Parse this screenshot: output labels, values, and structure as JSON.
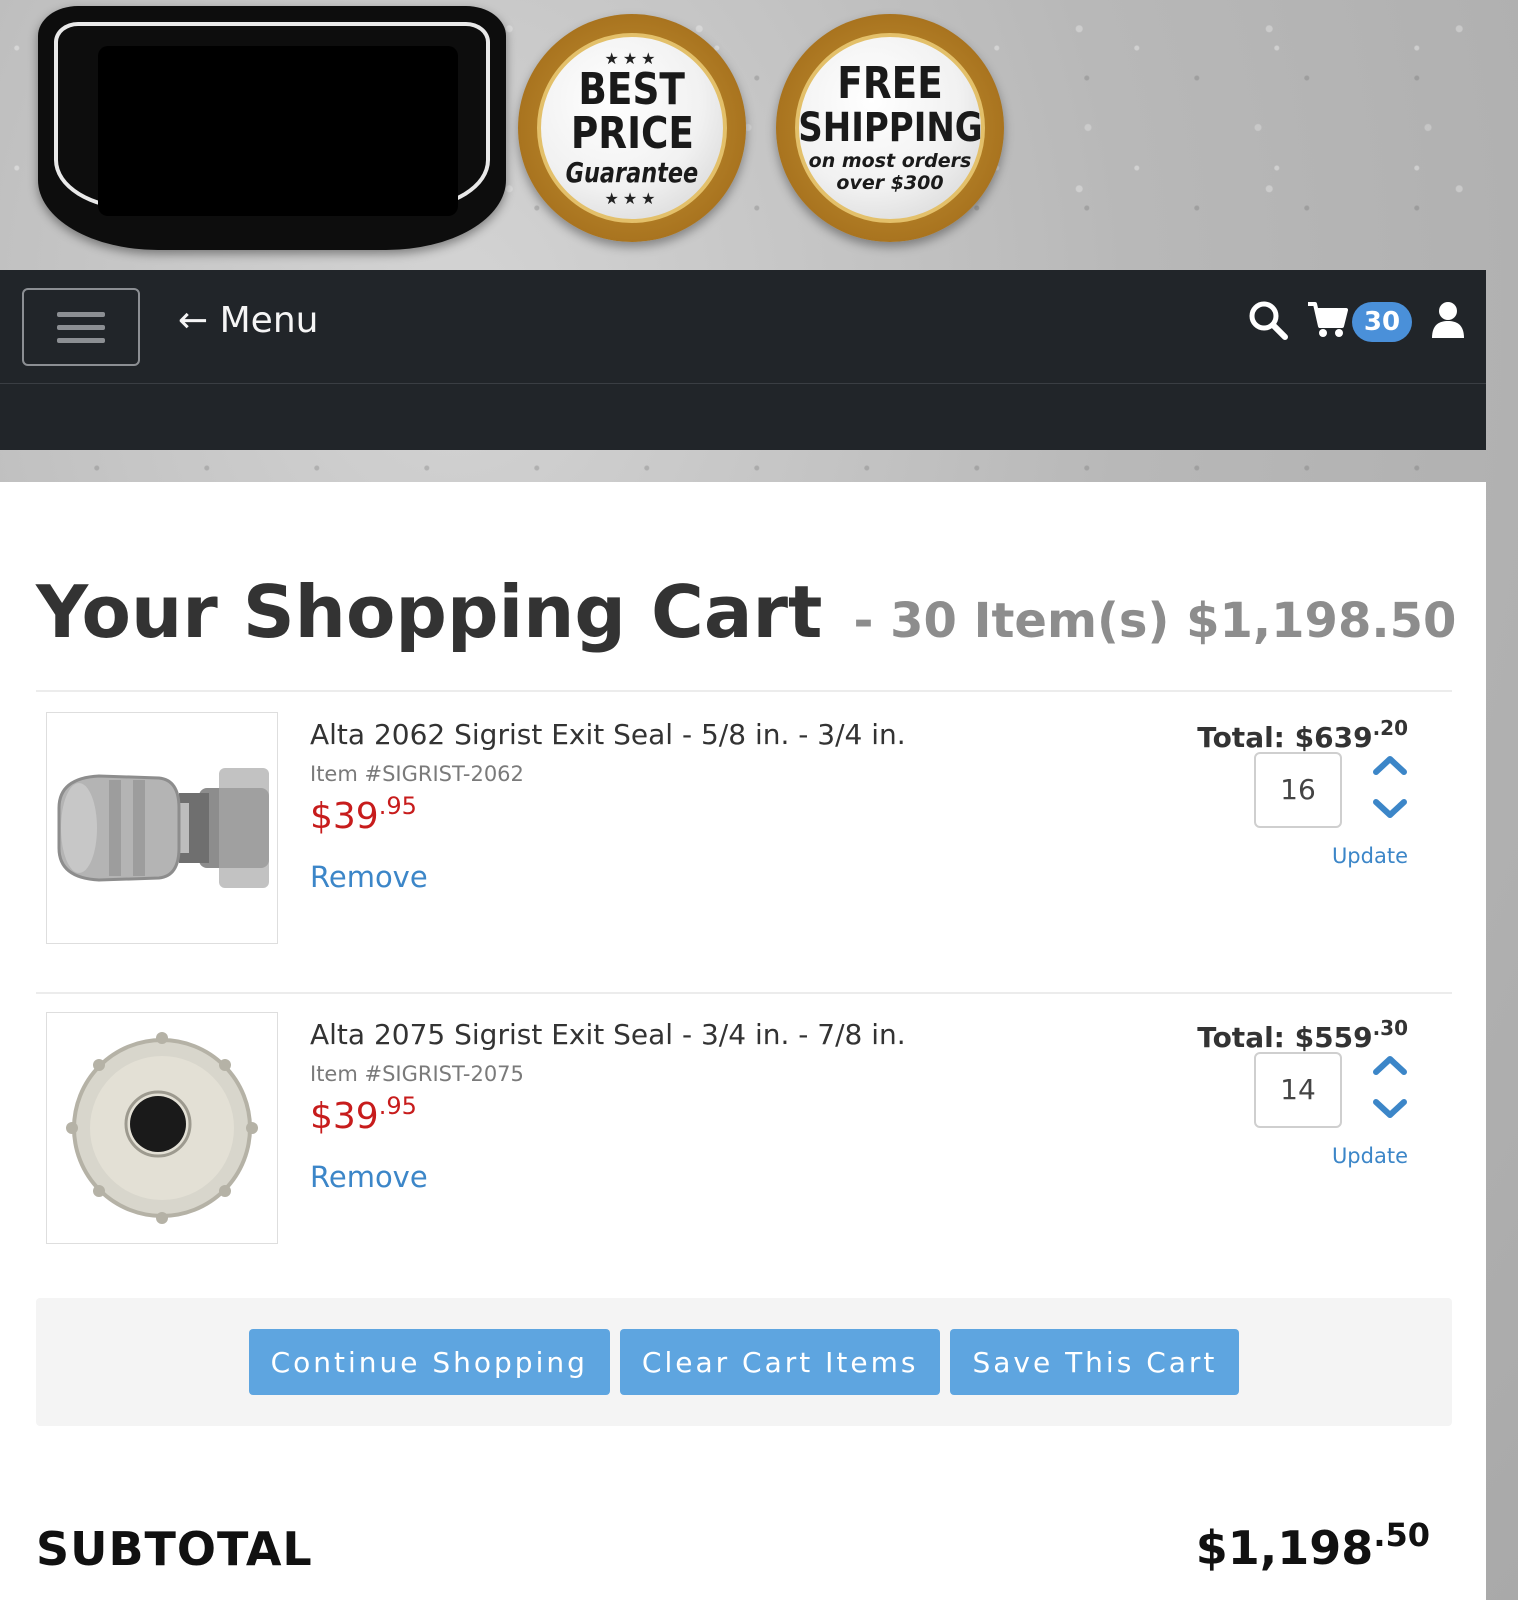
{
  "header": {
    "badge_best_price": {
      "line1": "BEST",
      "line2": "PRICE",
      "line3": "Guarantee",
      "stars": "★★★"
    },
    "badge_free_shipping": {
      "line1": "FREE",
      "line2": "SHIPPING",
      "line3": "on most orders",
      "line4": "over $300"
    }
  },
  "nav": {
    "menu_label": "← Menu",
    "cart_count": "30",
    "icons": [
      "hamburger-icon",
      "search-icon",
      "cart-icon",
      "user-icon"
    ]
  },
  "cart": {
    "title": "Your Shopping Cart",
    "summary": "- 30 Item(s) $1,198.50",
    "items": [
      {
        "name": "Alta 2062 Sigrist Exit Seal - 5/8 in. - 3/4 in.",
        "sku": "Item #SIGRIST-2062",
        "price_main": "$39",
        "price_cents": ".95",
        "remove_label": "Remove",
        "total_label": "Total: $639",
        "total_cents": ".20",
        "quantity": "16",
        "update_label": "Update"
      },
      {
        "name": "Alta 2075 Sigrist Exit Seal - 3/4 in. - 7/8 in.",
        "sku": "Item #SIGRIST-2075",
        "price_main": "$39",
        "price_cents": ".95",
        "remove_label": "Remove",
        "total_label": "Total: $559",
        "total_cents": ".30",
        "quantity": "14",
        "update_label": "Update"
      }
    ],
    "actions": {
      "continue_label": "Continue Shopping",
      "clear_label": "Clear Cart Items",
      "save_label": "Save This Cart"
    },
    "subtotal_label": "SUBTOTAL",
    "subtotal_main": "$1,198",
    "subtotal_cents": ".50"
  },
  "colors": {
    "nav_bg": "#212529",
    "accent_blue": "#5ea5e0",
    "link_blue": "#3c86c8",
    "price_red": "#c71c1c",
    "badge_blue": "#4a90d9"
  }
}
